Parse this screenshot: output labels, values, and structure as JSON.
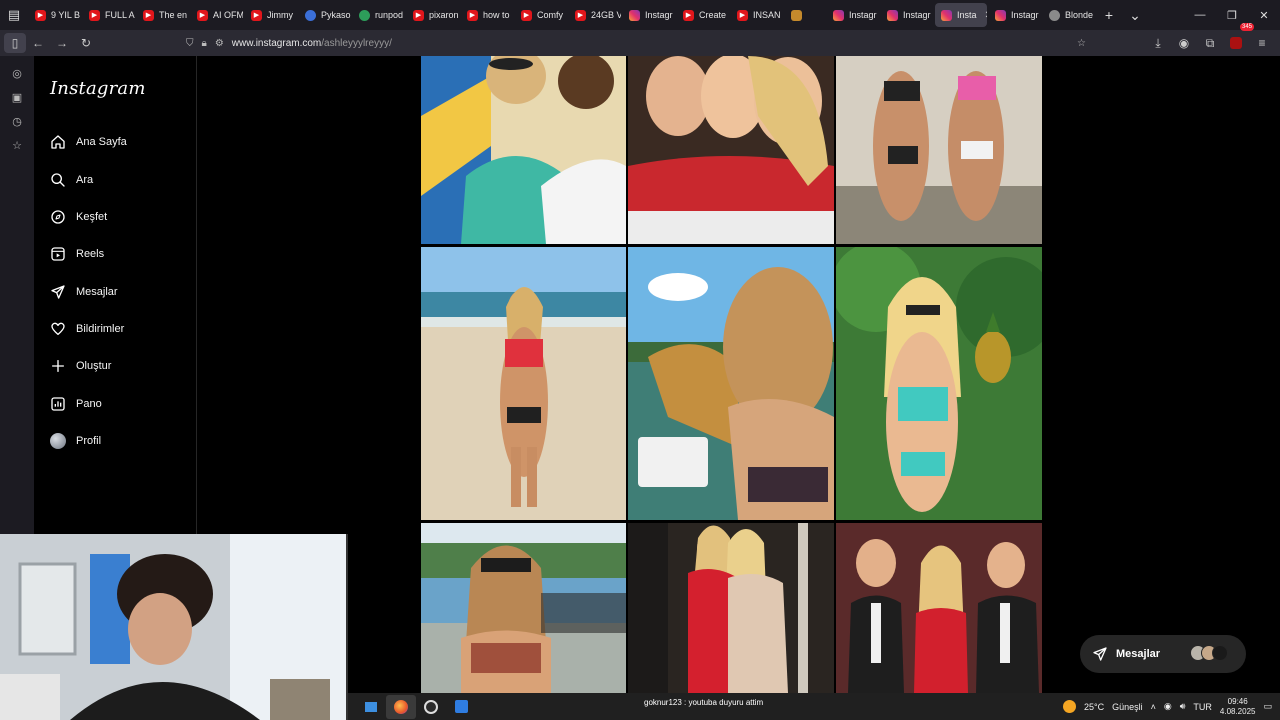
{
  "browser": {
    "tabs": [
      {
        "label": "9 YIL B",
        "icon": "youtube-icon",
        "active": false
      },
      {
        "label": "FULL A",
        "icon": "youtube-icon",
        "active": false
      },
      {
        "label": "The en",
        "icon": "youtube-icon",
        "active": false
      },
      {
        "label": "AI OFM",
        "icon": "youtube-icon",
        "active": false
      },
      {
        "label": "Jimmy",
        "icon": "youtube-icon",
        "active": false
      },
      {
        "label": "Pykaso",
        "icon": "pykaso-icon",
        "active": false
      },
      {
        "label": "runpod",
        "icon": "runpod-icon",
        "active": false
      },
      {
        "label": "pixaron",
        "icon": "youtube-icon",
        "active": false
      },
      {
        "label": "how to",
        "icon": "youtube-icon",
        "active": false
      },
      {
        "label": "Comfy",
        "icon": "youtube-icon",
        "active": false
      },
      {
        "label": "24GB V",
        "icon": "youtube-icon",
        "active": false
      },
      {
        "label": "Instagr",
        "icon": "instagram-icon",
        "active": false
      },
      {
        "label": "Create",
        "icon": "youtube-icon",
        "active": false
      },
      {
        "label": "INSAN",
        "icon": "youtube-icon",
        "active": false
      },
      {
        "label": "",
        "icon": "mixed-icon",
        "active": false
      },
      {
        "label": "Instagr",
        "icon": "instagram-icon",
        "active": false
      },
      {
        "label": "Instagr",
        "icon": "instagram-icon",
        "active": false
      },
      {
        "label": "Insta",
        "icon": "instagram-icon",
        "active": true
      },
      {
        "label": "Instagr",
        "icon": "instagram-icon",
        "active": false
      },
      {
        "label": "Blonde",
        "icon": "blonde-icon",
        "active": false
      }
    ],
    "url_host": "www.instagram.com",
    "url_path": "/ashleyyylreyyy/",
    "extension_badge": "345"
  },
  "instagram": {
    "logo": "Instagram",
    "nav": [
      {
        "label": "Ana Sayfa",
        "icon": "home-icon"
      },
      {
        "label": "Ara",
        "icon": "search-icon"
      },
      {
        "label": "Keşfet",
        "icon": "compass-icon"
      },
      {
        "label": "Reels",
        "icon": "reels-icon"
      },
      {
        "label": "Mesajlar",
        "icon": "messages-icon"
      },
      {
        "label": "Bildirimler",
        "icon": "heart-icon"
      },
      {
        "label": "Oluştur",
        "icon": "plus-icon"
      },
      {
        "label": "Pano",
        "icon": "dashboard-icon"
      },
      {
        "label": "Profil",
        "icon": "avatar-icon"
      }
    ],
    "messages_bubble": {
      "label": "Mesajlar"
    }
  },
  "taskbar": {
    "chat_text": "goknur123 : youtuba duyuru attim",
    "weather": "25°C",
    "weather_desc": "Güneşli",
    "lang": "TUR",
    "time": "09:46",
    "date": "4.08.2025"
  }
}
